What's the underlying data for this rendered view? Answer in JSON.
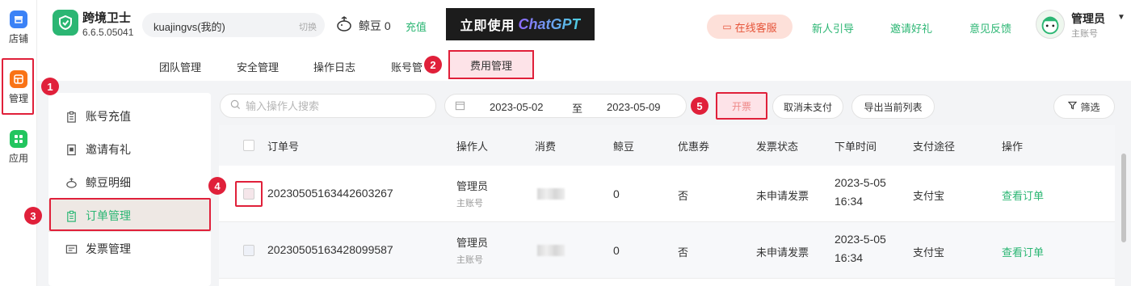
{
  "rail": {
    "items": [
      {
        "label": "店铺",
        "icon": "store-icon",
        "color": "#3b82f6"
      },
      {
        "label": "管理",
        "icon": "manage-icon",
        "color": "#f97316"
      },
      {
        "label": "应用",
        "icon": "apps-icon",
        "color": "#22c55e"
      }
    ]
  },
  "header": {
    "app_name": "跨境卫士",
    "version": "6.6.5.05041",
    "account": "kuajingvs(我的)",
    "switch_label": "切换",
    "beans": "鲸豆 0",
    "recharge": "充值",
    "banner_a": "立即使用",
    "banner_b": "ChatGPT",
    "customer_service": "在线客服",
    "links": [
      "新人引导",
      "邀请好礼",
      "意见反馈"
    ],
    "user_name": "管理员",
    "user_role": "主账号"
  },
  "subtabs": [
    "团队管理",
    "安全管理",
    "操作日志",
    "账号管",
    "费用管理"
  ],
  "side_menu": [
    "账号充值",
    "邀请有礼",
    "鲸豆明细",
    "订单管理",
    "发票管理"
  ],
  "toolbar": {
    "search_placeholder": "输入操作人搜索",
    "date_start": "2023-05-02",
    "date_sep": "至",
    "date_end": "2023-05-09",
    "invoice": "开票",
    "cancel_unpaid": "取消未支付",
    "export": "导出当前列表",
    "filter": "筛选"
  },
  "table": {
    "columns": [
      "订单号",
      "操作人",
      "消费",
      "鲸豆",
      "优惠券",
      "发票状态",
      "下单时间",
      "支付途径",
      "操作"
    ],
    "rows": [
      {
        "order_no": "20230505163442603267",
        "operator": "管理员",
        "operator_role": "主账号",
        "beans": "0",
        "coupon": "否",
        "invoice_status": "未申请发票",
        "date": "2023-5-05",
        "time": "16:34",
        "payment": "支付宝",
        "action": "查看订单"
      },
      {
        "order_no": "20230505163428099587",
        "operator": "管理员",
        "operator_role": "主账号",
        "beans": "0",
        "coupon": "否",
        "invoice_status": "未申请发票",
        "date": "2023-5-05",
        "time": "16:34",
        "payment": "支付宝",
        "action": "查看订单"
      }
    ]
  },
  "badges": [
    "1",
    "2",
    "3",
    "4",
    "5"
  ],
  "accent": "#2bb673",
  "highlight": "#e0203a"
}
